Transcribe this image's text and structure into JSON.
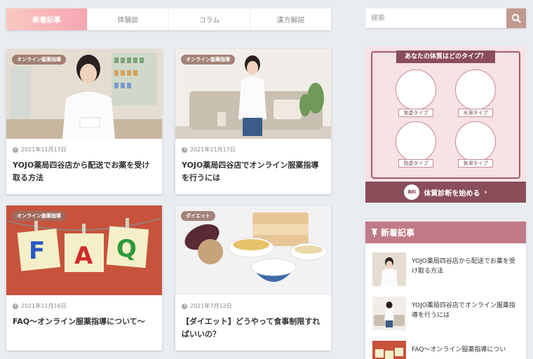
{
  "tabs": [
    {
      "label": "新着記事"
    },
    {
      "label": "体験談"
    },
    {
      "label": "コラム"
    },
    {
      "label": "漢方解説"
    }
  ],
  "cards": [
    {
      "badge": "オンライン服薬指導",
      "date": "2021年11月17日",
      "title": "YOJO薬局四谷店から配送でお薬を受け取る方法"
    },
    {
      "badge": "オンライン服薬指導",
      "date": "2021年11月17日",
      "title": "YOJO薬局四谷店でオンライン服薬指導を行うには"
    },
    {
      "badge": "オンライン服薬指導",
      "date": "2021年11月16日",
      "title": "FAQ〜オンライン服薬指導について〜"
    },
    {
      "badge": "ダイエット",
      "date": "2021年7月12日",
      "title": "【ダイエット】どうやって食事制限すればいいの？"
    }
  ],
  "faq_letters": [
    "F",
    "A",
    "Q"
  ],
  "search": {
    "placeholder": "検索"
  },
  "banner": {
    "title": "あなたの体質はどのタイプ？",
    "types": [
      "気虚タイプ",
      "水滞タイプ",
      "陰虚タイプ",
      "気滞タイプ"
    ],
    "free": "無料",
    "cta": "体質診断を始める"
  },
  "widget": {
    "title": "新着記事",
    "posts": [
      {
        "title": "YOJO薬局四谷店から配送でお薬を受け取る方法"
      },
      {
        "title": "YOJO薬局四谷店でオンライン服薬指導を行うには"
      },
      {
        "title": "FAQ〜オンライン服薬指導につい"
      }
    ]
  },
  "colors": {
    "accent": "#f6a6b2",
    "brand": "#8a4d5a",
    "widget_head": "#c07a87"
  }
}
